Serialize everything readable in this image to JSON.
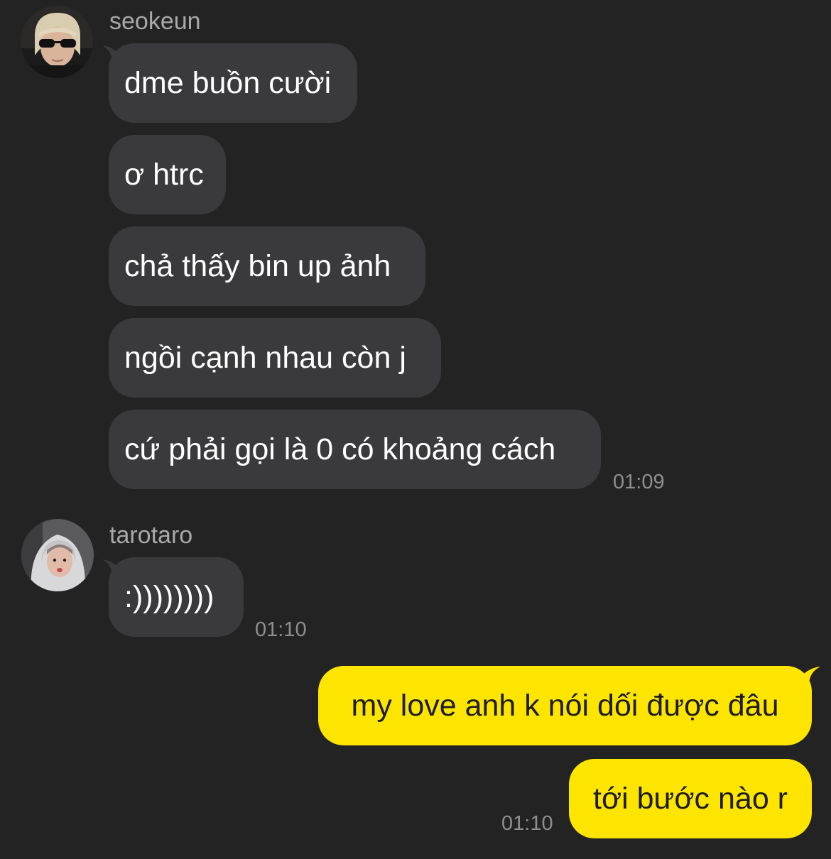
{
  "colors": {
    "background": "#232323",
    "incoming_bubble": "#3a3a3c",
    "outgoing_bubble": "#fee500",
    "sender_name": "#a9a9a9",
    "timestamp": "#8e8e8e"
  },
  "groups": [
    {
      "sender": "seokeun",
      "avatar_icon": "user-avatar-sunglasses",
      "messages": [
        "dme buồn cười",
        "ơ htrc",
        "chả thấy bin up ảnh",
        "ngồi cạnh nhau còn j",
        "cứ phải gọi là 0 có khoảng cách"
      ],
      "time": "01:09"
    },
    {
      "sender": "tarotaro",
      "avatar_icon": "user-avatar-hoodie",
      "messages": [
        ":))))))))"
      ],
      "time": "01:10"
    }
  ],
  "outgoing": {
    "messages": [
      "my love anh k nói dối được đâu",
      "tới bước nào r"
    ],
    "time": "01:10"
  }
}
